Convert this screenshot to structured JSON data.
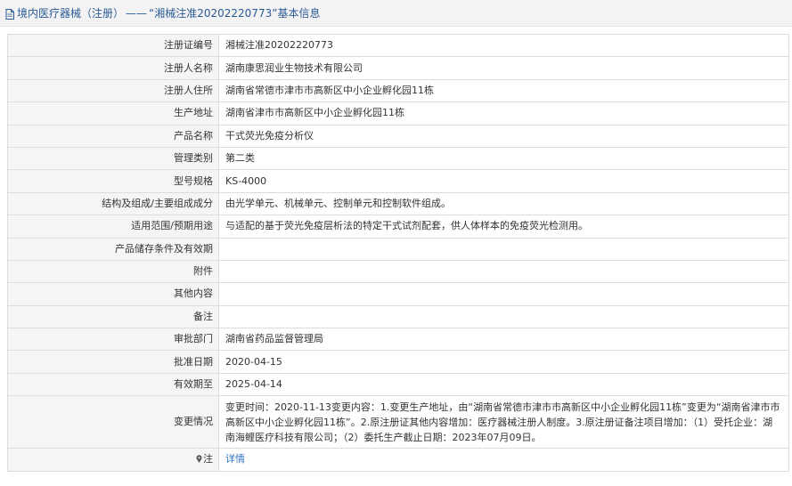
{
  "header": {
    "category": "境内医疗器械（注册）",
    "separator": "——",
    "reg_quote": "“湘械注准20202220773”",
    "suffix": "基本信息"
  },
  "rows": [
    {
      "label": "注册证编号",
      "value": "湘械注准20202220773"
    },
    {
      "label": "注册人名称",
      "value": "湖南康思润业生物技术有限公司"
    },
    {
      "label": "注册人住所",
      "value": "湖南省常德市津市市高新区中小企业孵化园11栋"
    },
    {
      "label": "生产地址",
      "value": "湖南省津市市高新区中小企业孵化园11栋"
    },
    {
      "label": "产品名称",
      "value": "干式荧光免疫分析仪"
    },
    {
      "label": "管理类别",
      "value": "第二类"
    },
    {
      "label": "型号规格",
      "value": "KS-4000"
    },
    {
      "label": "结构及组成/主要组成成分",
      "value": "由光学单元、机械单元、控制单元和控制软件组成。"
    },
    {
      "label": "适用范围/预期用途",
      "value": "与适配的基于荧光免疫层析法的特定干式试剂配套，供人体样本的免疫荧光检测用。"
    },
    {
      "label": "产品储存条件及有效期",
      "value": ""
    },
    {
      "label": "附件",
      "value": ""
    },
    {
      "label": "其他内容",
      "value": ""
    },
    {
      "label": "备注",
      "value": ""
    },
    {
      "label": "审批部门",
      "value": "湖南省药品监督管理局"
    },
    {
      "label": "批准日期",
      "value": "2020-04-15"
    },
    {
      "label": "有效期至",
      "value": "2025-04-14"
    },
    {
      "label": "变更情况",
      "value": "变更时间：2020-11-13变更内容：1.变更生产地址，由“湖南省常德市津市市高新区中小企业孵化园11栋”变更为“湖南省津市市高新区中小企业孵化园11栋”。2.原注册证其他内容增加：医疗器械注册人制度。3.原注册证备注项目增加：（1）受托企业：湖南海鲤医疗科技有限公司；（2）委托生产截止日期：2023年07月09日。"
    }
  ],
  "note_row": {
    "icon": "pin-icon",
    "label": "注",
    "link_text": "详情",
    "link_color": "#3173c4"
  },
  "colors": {
    "header_text": "#2a5a96",
    "label_bg": "#f5f5f5",
    "border": "#dcdcdc"
  }
}
